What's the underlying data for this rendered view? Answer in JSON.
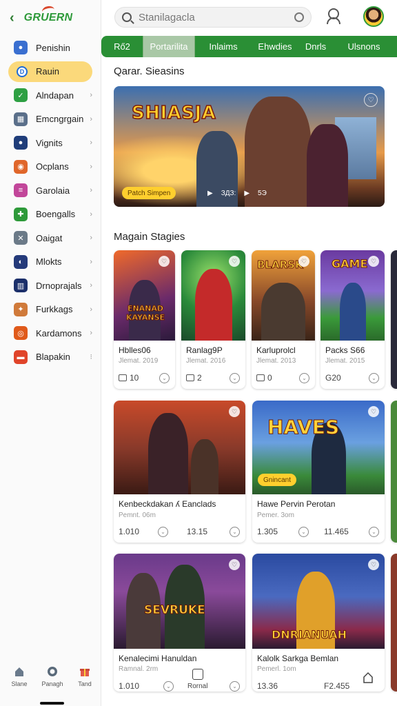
{
  "header": {
    "back_icon": "chevron-left-icon",
    "logo": "GRUERN",
    "search_placeholder": "Stanilagacla",
    "user_icon": "user-icon",
    "avatar_icon": "avatar"
  },
  "sidebar": {
    "items": [
      {
        "label": "Penishin",
        "icon": "globe-icon",
        "color": "#3a6fd0",
        "active": false,
        "chevron": ""
      },
      {
        "label": "Rauin",
        "icon": "d-icon",
        "color": "#1e6bd6",
        "active": true,
        "chevron": ""
      },
      {
        "label": "Alndapan",
        "icon": "leaf-icon",
        "color": "#2ea043",
        "active": false,
        "chevron": "›"
      },
      {
        "label": "Emcngrgain",
        "icon": "grid-icon",
        "color": "#5a6f8a",
        "active": false,
        "chevron": "›"
      },
      {
        "label": "Vignits",
        "icon": "circle-icon",
        "color": "#1f3d7a",
        "active": false,
        "chevron": "›"
      },
      {
        "label": "Ocplans",
        "icon": "orb-icon",
        "color": "#e0662a",
        "active": false,
        "chevron": "›"
      },
      {
        "label": "Garolaia",
        "icon": "chart-icon",
        "color": "#c2469a",
        "active": false,
        "chevron": "›"
      },
      {
        "label": "Boengalls",
        "icon": "puzzle-icon",
        "color": "#2e9a3a",
        "active": false,
        "chevron": "›"
      },
      {
        "label": "Oaigat",
        "icon": "x-icon",
        "color": "#6b7a88",
        "active": false,
        "chevron": "›"
      },
      {
        "label": "Mlokts",
        "icon": "mask-icon",
        "color": "#243a7a",
        "active": false,
        "chevron": "›"
      },
      {
        "label": "Drnoprajals",
        "icon": "block-icon",
        "color": "#1b2f6a",
        "active": false,
        "chevron": "›"
      },
      {
        "label": "Furkkags",
        "icon": "dog-icon",
        "color": "#d07a3a",
        "active": false,
        "chevron": "›"
      },
      {
        "label": "Kardamons",
        "icon": "target-icon",
        "color": "#e05a1a",
        "active": false,
        "chevron": "›"
      },
      {
        "label": "Blapakin",
        "icon": "flag-icon",
        "color": "#e0442a",
        "active": false,
        "chevron": "⁝"
      }
    ]
  },
  "tabs": [
    "Rő2",
    "Portarilita",
    "Inlaims",
    "Ehwdies",
    "Dnrls",
    "Ulsnons"
  ],
  "featured": {
    "section_title": "Qarar. Sieasins",
    "logo_text": "SHIASJA",
    "badge": "Patch Simpen",
    "meta": [
      "▶",
      "ЗДЗ:",
      "▶",
      "5Э"
    ]
  },
  "grid": {
    "section_title": "Magain Stagies",
    "row1": [
      {
        "art": "ENANAD\nKAYANSE",
        "name": "Hblles06",
        "sub": "Jlemat. 2019",
        "stat": "10",
        "stat_icon": "box"
      },
      {
        "art": "",
        "name": "Ranlag9P",
        "sub": "Jlemat. 2016",
        "stat": "2",
        "stat_icon": "box"
      },
      {
        "art": "BLARSK",
        "name": "Karluprolcl",
        "sub": "Jlemat. 2013",
        "stat": "0",
        "stat_icon": "box"
      },
      {
        "art": "GAME",
        "name": "Packs S66",
        "sub": "Jlemat. 2015",
        "stat": "G20",
        "stat_icon": ""
      }
    ],
    "row2": [
      {
        "art": "",
        "name": "Kenbeckdakan ʎ Eanclads",
        "sub": "Pemnt. 06m",
        "stat_a": "1.010",
        "stat_b": "13.15"
      },
      {
        "art": "HAVES",
        "badge": "Gnincant",
        "name": "Hawe Pervin Perotan",
        "sub": "Pemer. 3om",
        "stat_a": "1.305",
        "stat_b": "11.465"
      }
    ],
    "row3": [
      {
        "art": "SEVRUKE",
        "name": "Kenalecimi Hanuldan",
        "sub": "Ramnal. 2rm",
        "stat_a": "1.010",
        "stat_b": "Rornal"
      },
      {
        "art": "DNRIANUAH",
        "name": "Kalolk Sarkga Bemlan",
        "sub": "Pemerl. 1om",
        "stat_a": "13.36",
        "stat_b": "F2.455"
      }
    ]
  },
  "bottom_nav": [
    {
      "label": "Slane",
      "icon": "home-icon"
    },
    {
      "label": "Panagh",
      "icon": "o-icon"
    },
    {
      "label": "Tand",
      "icon": "gift-icon"
    }
  ]
}
